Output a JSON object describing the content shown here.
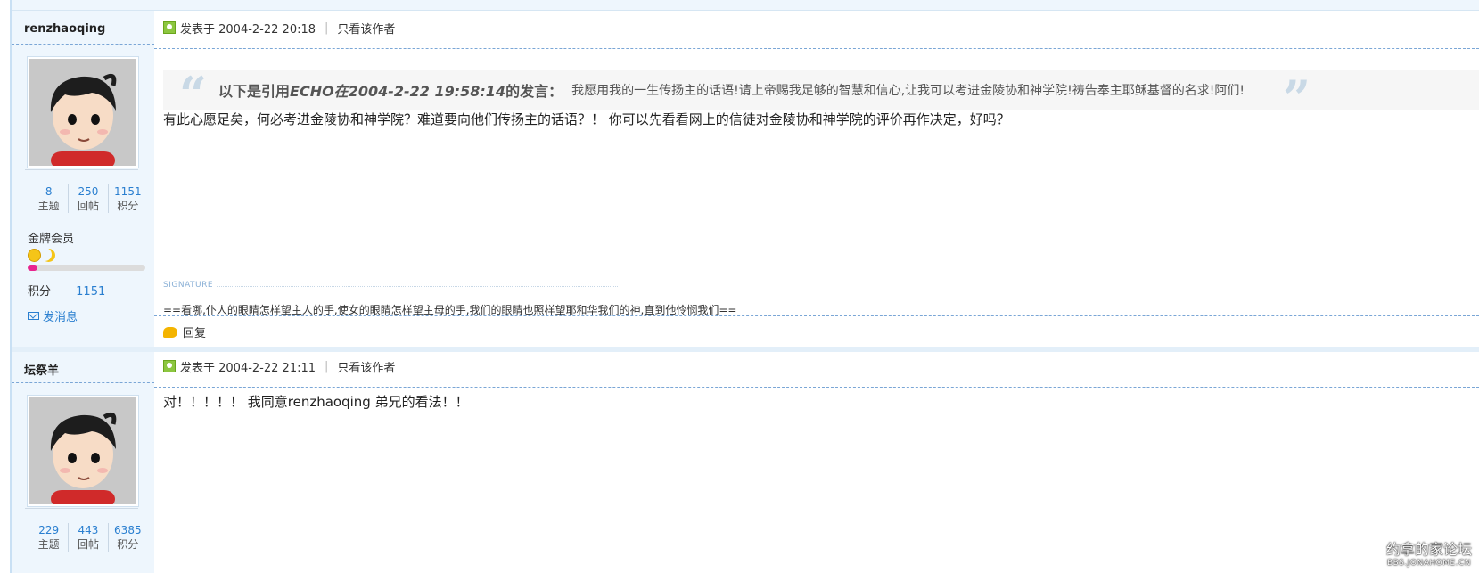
{
  "posts": [
    {
      "author": {
        "name": "renzhaoqing",
        "stats": [
          {
            "value": "8",
            "label": "主题"
          },
          {
            "value": "250",
            "label": "回帖"
          },
          {
            "value": "1151",
            "label": "积分"
          }
        ],
        "rank": "金牌会员",
        "level_progress": 0.08,
        "points_label": "积分",
        "points_value": "1151",
        "message_label": "发消息"
      },
      "header": {
        "posted": "发表于 2004-2-22 20:18",
        "only_author": "只看该作者"
      },
      "quote": {
        "label_prefix": "以下是引用",
        "label_name": "ECHO在2004-2-22 19:58:14",
        "label_suffix": "的发言：",
        "text": "我愿用我的一生传扬主的话语!请上帝赐我足够的智慧和信心,让我可以考进金陵协和神学院!祷告奉主耶稣基督的名求!阿们!"
      },
      "body": "有此心愿足矣，何必考进金陵协和神学院？难道要向他们传扬主的话语？！  你可以先看看网上的信徒对金陵协和神学院的评价再作决定，好吗？",
      "signature_label": "SIGNATURE",
      "signature": "==看哪,仆人的眼睛怎样望主人的手,使女的眼睛怎样望主母的手,我们的眼睛也照样望耶和华我们的神,直到他怜悯我们==",
      "reply_label": "回复"
    },
    {
      "author": {
        "name": "坛祭羊",
        "stats": [
          {
            "value": "229",
            "label": "主题"
          },
          {
            "value": "443",
            "label": "回帖"
          },
          {
            "value": "6385",
            "label": "积分"
          }
        ]
      },
      "header": {
        "posted": "发表于 2004-2-22 21:11",
        "only_author": "只看该作者"
      },
      "body": "对！！！！！  我同意renzhaoqing 弟兄的看法！！"
    }
  ],
  "watermark": {
    "line1": "约拿的家论坛",
    "line2": "BBS.JONAHOME.CN"
  },
  "icons": {
    "post": "post-user-icon",
    "reply": "reply-bubble-icon",
    "message": "mail-icon",
    "rank": "smile-moon-icons"
  },
  "colors": {
    "accent_link": "#2a7fd0",
    "sidebar_bg": "#eef6fd",
    "level_bar": "#e8238f",
    "dashed_line": "#7aa6d6"
  }
}
